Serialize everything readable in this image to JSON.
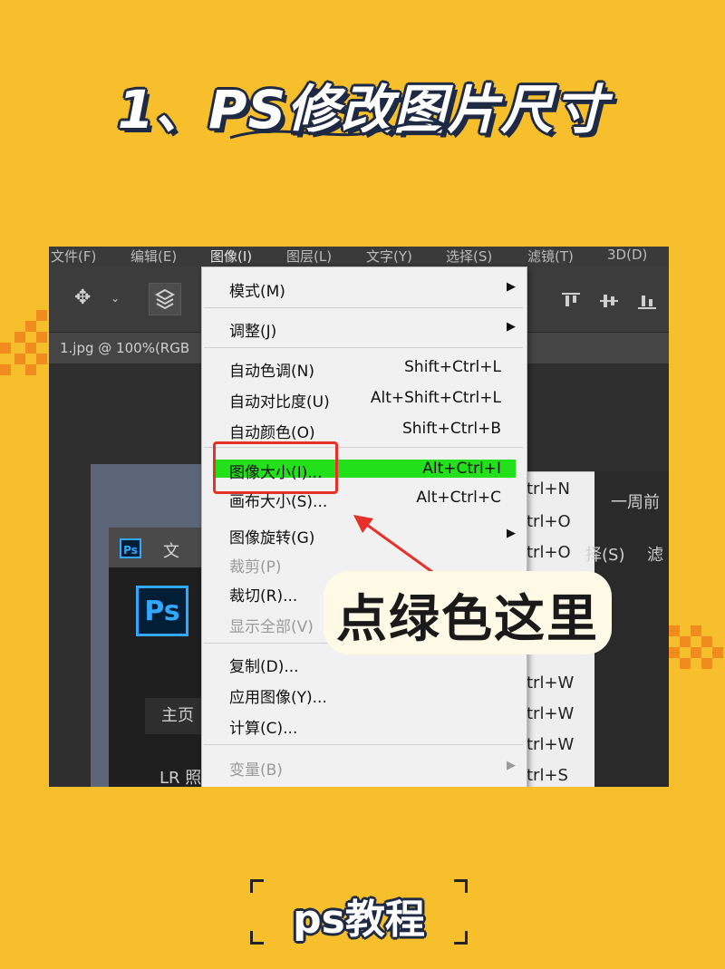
{
  "heading": "1、PS修改图片尺寸",
  "menubar": {
    "items": [
      "文件(F)",
      "编辑(E)",
      "图像(I)",
      "图层(L)",
      "文字(Y)",
      "选择(S)",
      "滤镜(T)",
      "3D(D)"
    ]
  },
  "tab": {
    "title": "1.jpg @ 100%(RGB"
  },
  "image_menu": {
    "items": [
      {
        "label": "模式(M)",
        "shortcut": "",
        "submenu": true,
        "disabled": false
      },
      {
        "label": "调整(J)",
        "shortcut": "",
        "submenu": true,
        "disabled": false
      },
      {
        "label": "自动色调(N)",
        "shortcut": "Shift+Ctrl+L",
        "submenu": false,
        "disabled": false
      },
      {
        "label": "自动对比度(U)",
        "shortcut": "Alt+Shift+Ctrl+L",
        "submenu": false,
        "disabled": false
      },
      {
        "label": "自动颜色(O)",
        "shortcut": "Shift+Ctrl+B",
        "submenu": false,
        "disabled": false
      },
      {
        "label": "图像大小(I)...",
        "shortcut": "Alt+Ctrl+I",
        "submenu": false,
        "disabled": false
      },
      {
        "label": "画布大小(S)...",
        "shortcut": "Alt+Ctrl+C",
        "submenu": false,
        "disabled": false
      },
      {
        "label": "图像旋转(G)",
        "shortcut": "",
        "submenu": true,
        "disabled": false
      },
      {
        "label": "裁剪(P)",
        "shortcut": "",
        "submenu": false,
        "disabled": true
      },
      {
        "label": "裁切(R)...",
        "shortcut": "",
        "submenu": false,
        "disabled": false
      },
      {
        "label": "显示全部(V)",
        "shortcut": "",
        "submenu": false,
        "disabled": true
      },
      {
        "label": "复制(D)...",
        "shortcut": "",
        "submenu": false,
        "disabled": false
      },
      {
        "label": "应用图像(Y)...",
        "shortcut": "",
        "submenu": false,
        "disabled": false
      },
      {
        "label": "计算(C)...",
        "shortcut": "",
        "submenu": false,
        "disabled": false
      },
      {
        "label": "变量(B)",
        "shortcut": "",
        "submenu": true,
        "disabled": true
      }
    ]
  },
  "background_submenu": {
    "items": [
      "trl+N",
      "trl+O",
      "trl+O",
      "trl+W",
      "trl+W",
      "trl+W",
      "trl+S"
    ]
  },
  "background_window": {
    "ps_logo": "Ps",
    "file_menu": "文",
    "home": "主页",
    "lr": "LR 照",
    "recent": "一周前",
    "select": "择(S)",
    "filter": "滤"
  },
  "annotation": {
    "text": "点绿色这里",
    "highlight_color": "#22e01a",
    "box_color": "#e8302a"
  },
  "footer": {
    "label": "ps教程"
  },
  "colors": {
    "background": "#f8bf2c",
    "accent": "#f28b1d",
    "ps_blue": "#31a8ff"
  }
}
